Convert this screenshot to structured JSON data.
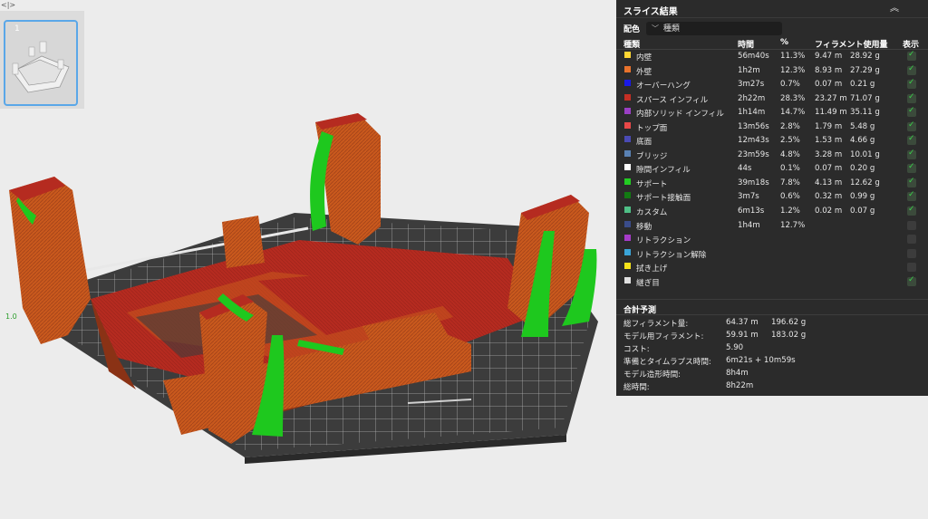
{
  "plates": {
    "toggle_icon": "<|>",
    "items": [
      {
        "number": "1"
      }
    ]
  },
  "slice_panel": {
    "title": "スライス結果",
    "collapse_icon": "double-chevron-up-icon",
    "color_scheme": {
      "label": "配色",
      "value": "種類"
    },
    "columns": {
      "type": "種類",
      "time": "時間",
      "percent": "%",
      "filament": "フィラメント使用量",
      "show": "表示"
    },
    "rows": [
      {
        "color": "#ffd633",
        "name": "内壁",
        "time": "56m40s",
        "percent": "11.3%",
        "length": "9.47 m",
        "weight": "28.92 g",
        "visible": true
      },
      {
        "color": "#e8722c",
        "name": "外壁",
        "time": "1h2m",
        "percent": "12.3%",
        "length": "8.93 m",
        "weight": "27.29 g",
        "visible": true
      },
      {
        "color": "#1a1ae6",
        "name": "オーバーハング",
        "time": "3m27s",
        "percent": "0.7%",
        "length": "0.07 m",
        "weight": "0.21 g",
        "visible": true
      },
      {
        "color": "#c42f24",
        "name": "スパース インフィル",
        "time": "2h22m",
        "percent": "28.3%",
        "length": "23.27 m",
        "weight": "71.07 g",
        "visible": true
      },
      {
        "color": "#9a3fc4",
        "name": "内部ソリッド インフィル",
        "time": "1h14m",
        "percent": "14.7%",
        "length": "11.49 m",
        "weight": "35.11 g",
        "visible": true
      },
      {
        "color": "#e84848",
        "name": "トップ面",
        "time": "13m56s",
        "percent": "2.8%",
        "length": "1.79 m",
        "weight": "5.48 g",
        "visible": true
      },
      {
        "color": "#4a4ab4",
        "name": "底面",
        "time": "12m43s",
        "percent": "2.5%",
        "length": "1.53 m",
        "weight": "4.66 g",
        "visible": true
      },
      {
        "color": "#5a82b4",
        "name": "ブリッジ",
        "time": "23m59s",
        "percent": "4.8%",
        "length": "3.28 m",
        "weight": "10.01 g",
        "visible": true
      },
      {
        "color": "#ffffff",
        "name": "隙間インフィル",
        "time": "44s",
        "percent": "0.1%",
        "length": "0.07 m",
        "weight": "0.20 g",
        "visible": true
      },
      {
        "color": "#22cc22",
        "name": "サポート",
        "time": "39m18s",
        "percent": "7.8%",
        "length": "4.13 m",
        "weight": "12.62 g",
        "visible": true
      },
      {
        "color": "#127a12",
        "name": "サポート接触面",
        "time": "3m7s",
        "percent": "0.6%",
        "length": "0.32 m",
        "weight": "0.99 g",
        "visible": true
      },
      {
        "color": "#4fbf86",
        "name": "カスタム",
        "time": "6m13s",
        "percent": "1.2%",
        "length": "0.02 m",
        "weight": "0.07 g",
        "visible": true
      },
      {
        "color": "#3a4c8a",
        "name": "移動",
        "time": "1h4m",
        "percent": "12.7%",
        "length": "",
        "weight": "",
        "visible": false
      },
      {
        "color": "#a63bc8",
        "name": "リトラクション",
        "time": "",
        "percent": "",
        "length": "",
        "weight": "",
        "visible": false
      },
      {
        "color": "#3aa4d8",
        "name": "リトラクション解除",
        "time": "",
        "percent": "",
        "length": "",
        "weight": "",
        "visible": false
      },
      {
        "color": "#f5e21a",
        "name": "拭き上げ",
        "time": "",
        "percent": "",
        "length": "",
        "weight": "",
        "visible": false
      },
      {
        "color": "#e0e0e0",
        "name": "継ぎ目",
        "time": "",
        "percent": "",
        "length": "",
        "weight": "",
        "visible": true
      }
    ],
    "totals": {
      "title": "合計予測",
      "items": [
        {
          "label": "総フィラメント量:",
          "value": "64.37 m",
          "value2": "196.62 g"
        },
        {
          "label": "モデル用フィラメント:",
          "value": "59.91 m",
          "value2": "183.02 g"
        },
        {
          "label": "コスト:",
          "value": "5.90",
          "value2": ""
        },
        {
          "label": "準備とタイムラプス時間:",
          "value": "6m21s + 10m59s",
          "value2": ""
        },
        {
          "label": "モデル造形時間:",
          "value": "8h4m",
          "value2": ""
        },
        {
          "label": "総時間:",
          "value": "8h22m",
          "value2": ""
        }
      ]
    }
  },
  "colors": {
    "viewport_bg": "#ececec",
    "panel_bg": "#2b2b2b",
    "bed": "#3a3a3a",
    "grid": "#9a9a9a",
    "print_orange": "#c8561c",
    "print_red": "#b22a20",
    "support_green": "#1ec81e",
    "accent_blue": "#5aa7e8",
    "check_green": "#3ad14a"
  }
}
